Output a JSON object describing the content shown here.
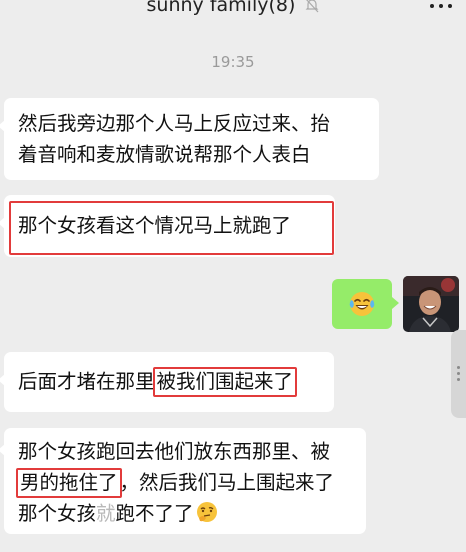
{
  "header": {
    "title": "sunny family(8)",
    "mute_icon": "bell-off-icon",
    "more_icon": "more-dots-icon"
  },
  "timestamp": "19:35",
  "messages": [
    {
      "direction": "received",
      "lines": [
        "然后我旁边那个人马上反应过来、抬",
        "着音响和麦放情歌说帮那个人表白"
      ]
    },
    {
      "direction": "received",
      "text": "那个女孩看这个情况马上就跑了",
      "highlighted": true
    },
    {
      "direction": "sent",
      "emoji": "tears-of-joy-emoji"
    },
    {
      "direction": "received",
      "text_before": "后面才堵在那里",
      "text_highlight": "被我们围起来了"
    },
    {
      "direction": "received",
      "line1": "那个女孩跑回去他们放东西那里、被",
      "line2_highlight": "男的拖住了",
      "line2_rest": "，然后我们马上围起来了",
      "line3_a": "那个女孩",
      "line3_blur": "就",
      "line3_b": "跑不了了",
      "line3_emoji": "thinking-face-emoji"
    }
  ],
  "colors": {
    "background": "#ededed",
    "bubble_received": "#ffffff",
    "bubble_sent": "#95ec69",
    "highlight_box": "#e23b3b",
    "timestamp": "#9a9a9a"
  }
}
